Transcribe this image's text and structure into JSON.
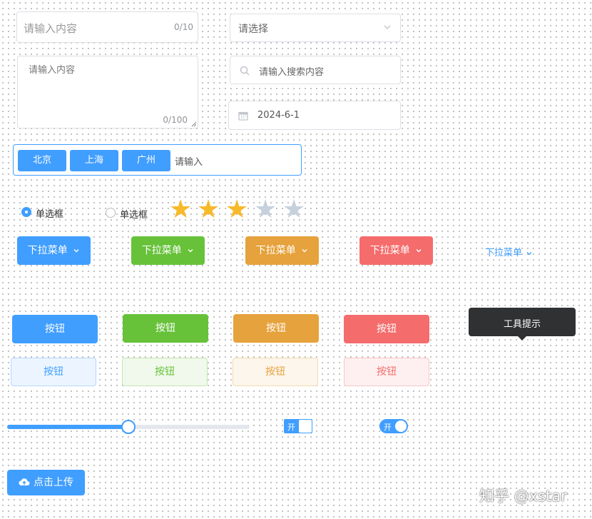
{
  "input": {
    "placeholder": "请输入内容",
    "count": "0/10"
  },
  "select": {
    "placeholder": "请选择"
  },
  "textarea": {
    "placeholder": "请输入内容",
    "count": "0/100"
  },
  "search": {
    "placeholder": "请输入搜索内容"
  },
  "date": {
    "value": "2024-6-1"
  },
  "tags": {
    "items": [
      "北京",
      "上海",
      "广州"
    ],
    "placeholder": "请输入"
  },
  "radios": [
    {
      "label": "单选框",
      "checked": true
    },
    {
      "label": "单选框",
      "checked": false
    }
  ],
  "rating": {
    "value": 3,
    "max": 5,
    "active_color": "#f7ba2a",
    "inactive_color": "#c6d1de"
  },
  "dropdowns": [
    {
      "label": "下拉菜单",
      "color": "#409eff"
    },
    {
      "label": "下拉菜单",
      "color": "#67c23a"
    },
    {
      "label": "下拉菜单",
      "color": "#e6a23c"
    },
    {
      "label": "下拉菜单",
      "color": "#f56c6c"
    },
    {
      "label": "下拉菜单",
      "color": "#409eff"
    }
  ],
  "buttons": [
    {
      "label": "按钮",
      "color": "#409eff"
    },
    {
      "label": "按钮",
      "color": "#67c23a"
    },
    {
      "label": "按钮",
      "color": "#e6a23c"
    },
    {
      "label": "按钮",
      "color": "#f56c6c"
    }
  ],
  "plain_buttons": [
    {
      "label": "按钮",
      "color": "#409eff"
    },
    {
      "label": "按钮",
      "color": "#67c23a"
    },
    {
      "label": "按钮",
      "color": "#e6a23c"
    },
    {
      "label": "按钮",
      "color": "#f56c6c"
    }
  ],
  "tooltip": {
    "text": "工具提示"
  },
  "slider": {
    "value": 50
  },
  "switches": [
    {
      "label": "开",
      "on": true
    },
    {
      "label": "开",
      "on": true
    }
  ],
  "upload": {
    "label": "点击上传"
  },
  "watermark": "知乎 @xstar"
}
